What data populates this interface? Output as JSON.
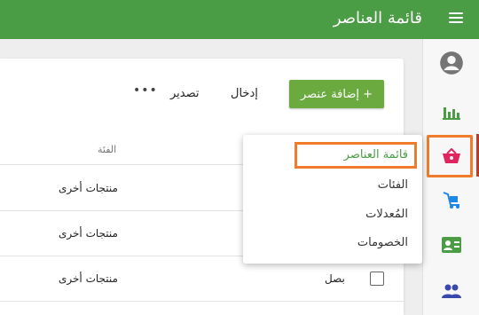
{
  "header": {
    "title": "قائمة العناصر"
  },
  "rail": {
    "items": [
      {
        "name": "profile",
        "icon": "account-circle-icon"
      },
      {
        "name": "reports",
        "icon": "bar-chart-icon"
      },
      {
        "name": "items",
        "icon": "basket-icon"
      },
      {
        "name": "sales",
        "icon": "cart-dolly-icon"
      },
      {
        "name": "customers",
        "icon": "contact-card-icon"
      },
      {
        "name": "employees",
        "icon": "people-icon"
      }
    ],
    "colors": {
      "profile": "#757575",
      "green": "#4a9d44",
      "basket": "#e0245e",
      "cart": "#1e88e5",
      "people": "#3949ab"
    }
  },
  "toolbar": {
    "add_label": "+ إضافة عنصر",
    "import_label": "إدخال",
    "export_label": "تصدير",
    "more_label": "•••"
  },
  "table": {
    "category_header": "الفئة",
    "rows": [
      {
        "category": "منتجات أخرى",
        "name": ""
      },
      {
        "category": "منتجات أخرى",
        "name": ""
      },
      {
        "category": "منتجات أخرى",
        "name": "بصل"
      }
    ]
  },
  "dropdown": {
    "items": [
      "قائمة العناصر",
      "الفئات",
      "المُعدلات",
      "الخصومات"
    ]
  }
}
